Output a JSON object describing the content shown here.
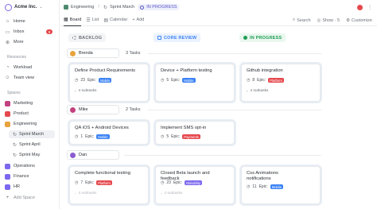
{
  "workspace": {
    "name": "Acme Inc."
  },
  "sidebar": {
    "items": [
      {
        "label": "Home",
        "icon": "home-icon"
      },
      {
        "label": "Inbox",
        "icon": "inbox-icon",
        "badge": "9"
      },
      {
        "label": "More",
        "icon": "more-icon"
      }
    ],
    "resources_label": "Resources",
    "resources": [
      {
        "label": "Workload",
        "icon": "workload-icon"
      },
      {
        "label": "Team view",
        "icon": "team-view-icon"
      }
    ],
    "spaces_label": "Spaces",
    "spaces": [
      {
        "label": "Marketing",
        "color": "#c2417f"
      },
      {
        "label": "Product",
        "color": "#e5484d"
      },
      {
        "label": "Engineering",
        "color": "#e8a33d"
      }
    ],
    "sprints": [
      {
        "label": "Sprint March"
      },
      {
        "label": "Sprint April"
      },
      {
        "label": "Sprint May"
      }
    ],
    "more_spaces": [
      {
        "label": "Operations",
        "color": "#7b68ee"
      },
      {
        "label": "Finance",
        "color": "#7b68ee"
      },
      {
        "label": "HR",
        "color": "#7b68ee"
      }
    ],
    "add_space": "Add Space"
  },
  "topbar": {
    "breadcrumb": [
      "Engineering",
      "Sprint March"
    ],
    "status": "IN PROGRESS"
  },
  "views": {
    "tabs": [
      "Board",
      "List",
      "Calendar"
    ],
    "add": "Add",
    "actions": [
      "Search",
      "Show · 5",
      "Customize"
    ]
  },
  "columns": [
    {
      "label": "BACKLOG",
      "color": "#8a8f98",
      "bg": "#f3f4f6"
    },
    {
      "label": "CORE REVIEW",
      "color": "#3b82f6",
      "bg": "#eaf2fe"
    },
    {
      "label": "IN PROGRESS",
      "color": "#1f9d55",
      "bg": "#e9f7ee"
    }
  ],
  "groups": [
    {
      "assignee": "Brenda",
      "avatar_color": "#e8a33d",
      "count": "3 Tasks",
      "cards": [
        {
          "title": "Define Product Requirements",
          "points": "23",
          "epic": "Epic:",
          "tag": "Mobile",
          "tag_color": "#3b82f6",
          "subtasks": "4 subtasks"
        },
        {
          "title": "Device + Platform testing",
          "points": "5",
          "epic": "Epic:",
          "tag": "Mobile",
          "tag_color": "#3b82f6",
          "subtasks": ""
        },
        {
          "title": "Github integration",
          "points": "8",
          "epic": "Epic:",
          "tag": "Platform",
          "tag_color": "#e5484d",
          "subtasks": "4 subtasks"
        }
      ]
    },
    {
      "assignee": "Mike",
      "avatar_color": "#c2417f",
      "count": "2 Tasks",
      "cards": [
        {
          "title": "QA iOS + Android Devices",
          "points": "1",
          "epic": "Epic:",
          "tag": "Mobile",
          "tag_color": "#3b82f6",
          "subtasks": ""
        },
        {
          "title": "Implement SMS opt-in",
          "points": "5",
          "epic": "Epic:",
          "tag": "Payments",
          "tag_color": "#e5484d",
          "subtasks": ""
        }
      ]
    },
    {
      "assignee": "Dan",
      "avatar_color": "#8a5cd0",
      "count": "",
      "cards": [
        {
          "title": "Complete functional testing",
          "points": "7",
          "epic": "Epic:",
          "tag": "Platform",
          "tag_color": "#e5484d",
          "subtasks": "4 subtasks"
        },
        {
          "title": "Closed Beta launch and feedback",
          "points": "23",
          "epic": "Epic:",
          "tag": "Reliability",
          "tag_color": "#7b68ee",
          "subtasks": "4 subtasks"
        },
        {
          "title": "Css Animations notifications",
          "points": "11",
          "epic": "Epic:",
          "tag": "Mobile",
          "tag_color": "#3b82f6",
          "subtasks": ""
        }
      ]
    }
  ]
}
